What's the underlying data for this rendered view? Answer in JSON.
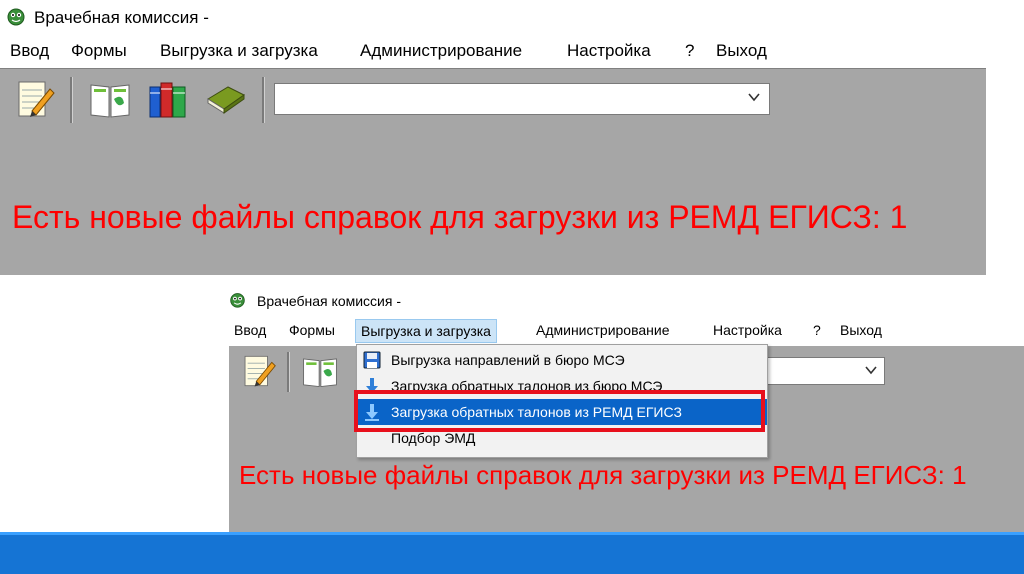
{
  "window1": {
    "title": "Врачебная комиссия -",
    "menu": [
      "Ввод",
      "Формы",
      "Выгрузка и загрузка",
      "Администрирование",
      "Настройка",
      "?",
      "Выход"
    ],
    "toolbar_icons": [
      "notepad-pen-icon",
      "open-book-icon",
      "books-stack-icon",
      "green-book-icon"
    ],
    "combo_value": "",
    "notice": "Есть новые файлы справок для загрузки из РЕМД ЕГИСЗ: 1"
  },
  "window2": {
    "title": "Врачебная комиссия -",
    "menu": [
      "Ввод",
      "Формы",
      "Выгрузка и загрузка",
      "Администрирование",
      "Настройка",
      "?",
      "Выход"
    ],
    "active_menu": "Выгрузка и загрузка",
    "toolbar_icons": [
      "notepad-pen-icon",
      "open-book-icon"
    ],
    "combo_value": "",
    "notice": "Есть новые файлы справок для загрузки из РЕМД ЕГИСЗ: 1",
    "dropdown": [
      {
        "label": "Выгрузка направлений в бюро МСЭ",
        "icon": "save-disk-icon"
      },
      {
        "label": "Загрузка обратных талонов из бюро МСЭ",
        "icon": "download-arrow-icon"
      },
      {
        "label": "Загрузка обратных талонов из РЕМД ЕГИСЗ",
        "icon": "download-arrow-icon",
        "highlighted": true
      },
      {
        "label": "Подбор ЭМД",
        "icon": ""
      }
    ]
  },
  "colors": {
    "notice": "#ff0000",
    "panel_gray": "#a6a6a6",
    "menu_highlight": "#0a64c8",
    "annotation_box": "#e8101c",
    "taskbar": "#1574d4"
  }
}
